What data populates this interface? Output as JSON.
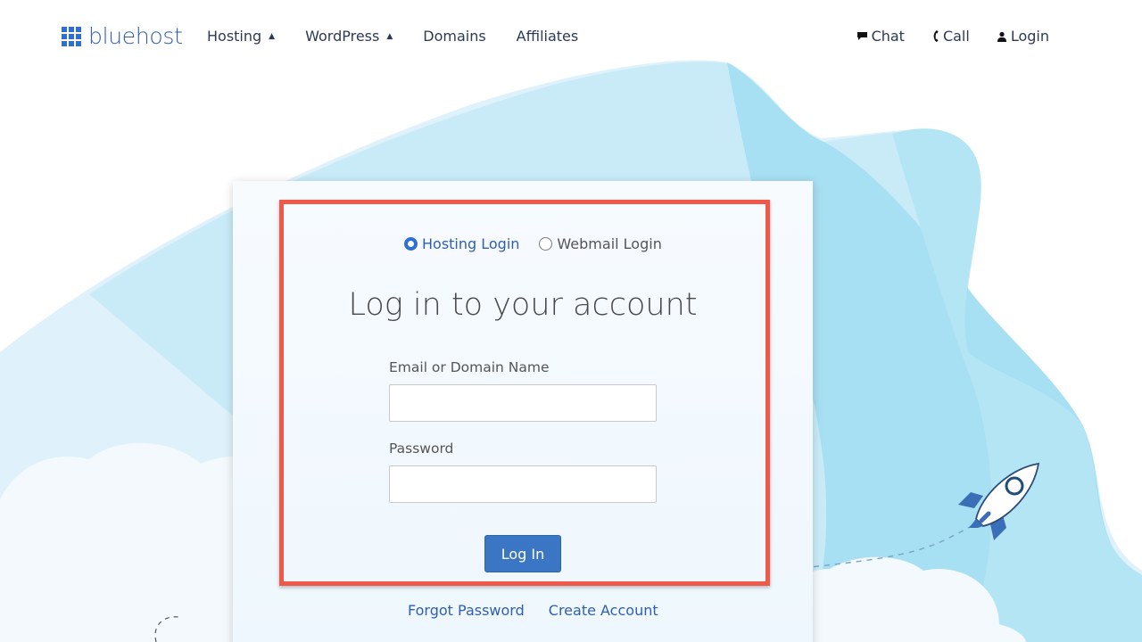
{
  "brand": {
    "name": "bluehost"
  },
  "nav": {
    "items": [
      {
        "label": "Hosting",
        "has_caret": true
      },
      {
        "label": "WordPress",
        "has_caret": true
      },
      {
        "label": "Domains",
        "has_caret": false
      },
      {
        "label": "Affiliates",
        "has_caret": false
      }
    ],
    "right": [
      {
        "label": "Chat",
        "icon": "chat-bubble-icon"
      },
      {
        "label": "Call",
        "icon": "phone-icon"
      },
      {
        "label": "Login",
        "icon": "user-icon"
      }
    ]
  },
  "login": {
    "options": [
      {
        "label": "Hosting Login",
        "selected": true
      },
      {
        "label": "Webmail Login",
        "selected": false
      }
    ],
    "title": "Log in to your account",
    "email_label": "Email or Domain Name",
    "email_value": "",
    "password_label": "Password",
    "password_value": "",
    "submit_label": "Log In",
    "forgot_label": "Forgot Password",
    "create_label": "Create Account"
  },
  "colors": {
    "accent": "#2f6ed6",
    "button": "#3a76c4",
    "highlight": "#f0584a",
    "background_wave": "#b9e4f5"
  }
}
